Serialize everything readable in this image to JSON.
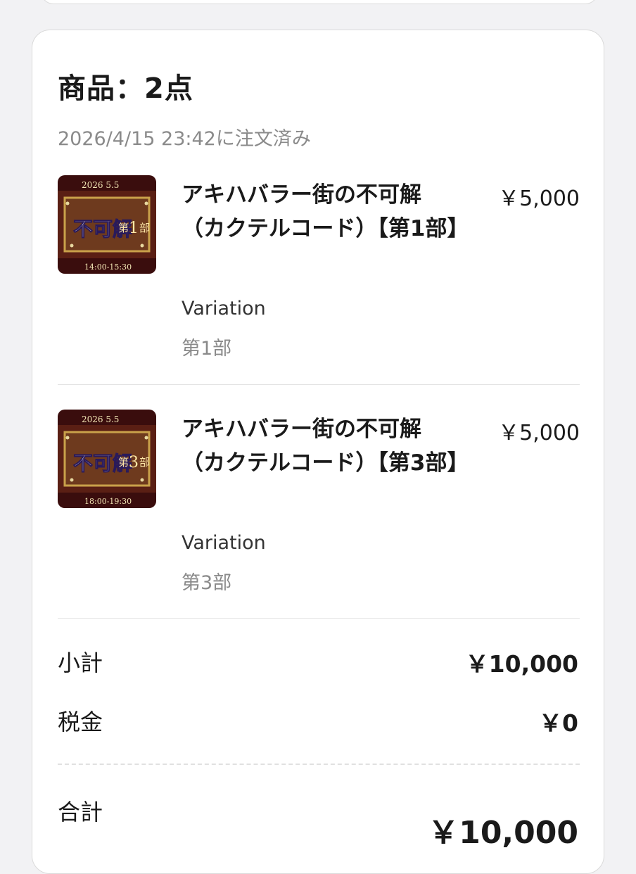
{
  "order": {
    "title": "商品：2点",
    "ordered_at": "2026/4/15 23:42に注文済み"
  },
  "items": [
    {
      "name": "アキハバラー街の不可解（カクテルコード）【第1部】",
      "price": "￥5,000",
      "variation_label": "Variation",
      "variation_value": "第1部",
      "thumb": {
        "date": "2026 5.5",
        "part_number": "1",
        "part_suffix": "部",
        "part_prefix": "第",
        "time": "14:00-15:30",
        "logo": "不可解"
      }
    },
    {
      "name": "アキハバラー街の不可解（カクテルコード）【第3部】",
      "price": "￥5,000",
      "variation_label": "Variation",
      "variation_value": "第3部",
      "thumb": {
        "date": "2026 5.5",
        "part_number": "3",
        "part_suffix": "部",
        "part_prefix": "第",
        "time": "18:00-19:30",
        "logo": "不可解"
      }
    }
  ],
  "summary": {
    "subtotal_label": "小計",
    "subtotal_value": "￥10,000",
    "tax_label": "税金",
    "tax_value": "￥0",
    "total_label": "合計",
    "total_value": "￥10,000"
  },
  "colors": {
    "thumb_bg": "#3a0d0d",
    "thumb_frame": "#c9a14a",
    "text_muted": "#8a8a8a"
  }
}
